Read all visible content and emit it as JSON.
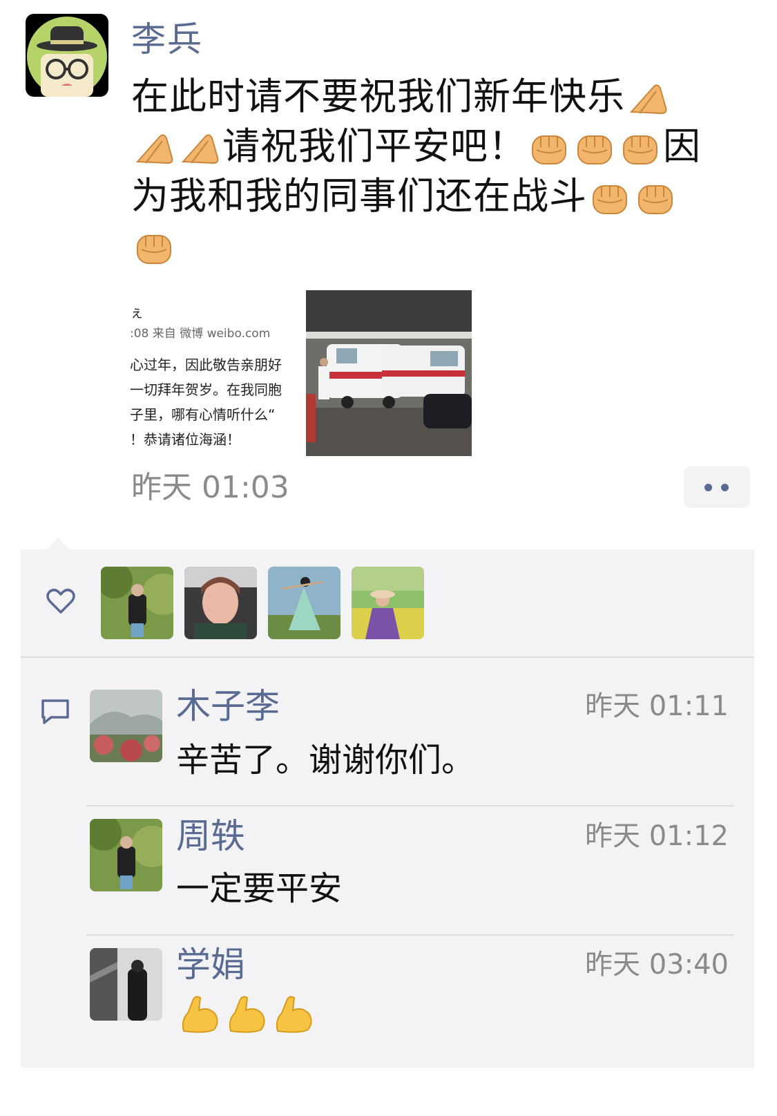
{
  "post": {
    "author": "李兵",
    "text_line1": "在此时请不要祝我们新年快乐",
    "text_line2": "请祝我们平安吧！",
    "text_line2b": "因",
    "text_line3": "为我和我的同事们还在战斗",
    "time": "昨天 01:03",
    "image1_lines": [
      "ぇ",
      ":08  来自 微博 weibo.com",
      "心过年，因此敬告亲朋好",
      "一切拜年贺岁。在我同胞",
      "子里，哪有心情听什么“",
      "！恭请诸位海涵！"
    ]
  },
  "likes": {
    "icon": "heart-icon",
    "count_avatars": 4
  },
  "comments": [
    {
      "name": "木子李",
      "time": "昨天 01:11",
      "text": "辛苦了。谢谢你们。"
    },
    {
      "name": "周轶",
      "time": "昨天 01:12",
      "text": "一定要平安"
    },
    {
      "name": "学娟",
      "time": "昨天 03:40",
      "text": ""
    }
  ],
  "colors": {
    "link": "#5a6b93",
    "time": "#8a8a8a",
    "panel": "#f3f3f5"
  }
}
